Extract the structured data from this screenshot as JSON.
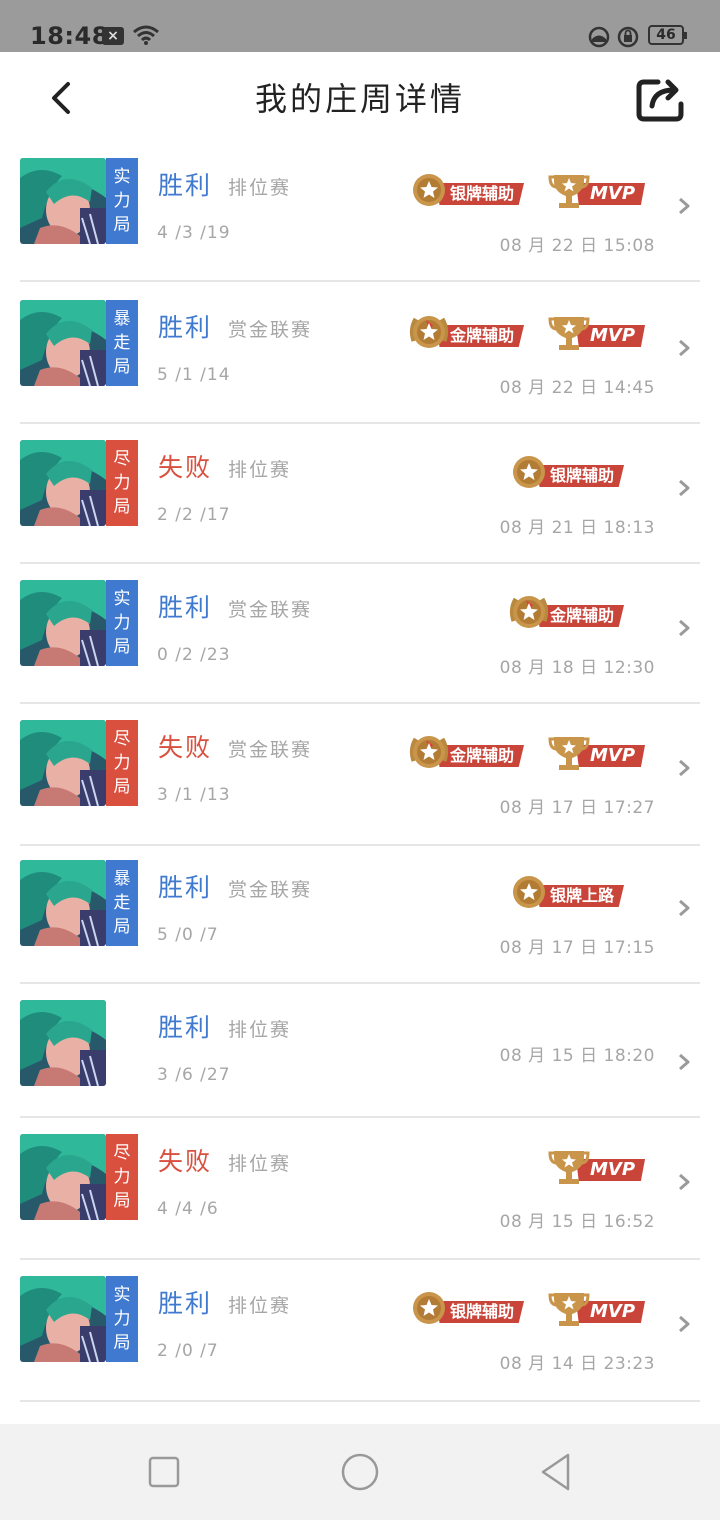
{
  "status_bar": {
    "time": "18:48",
    "battery": "46"
  },
  "header": {
    "title": "我的庄周详情"
  },
  "matches": [
    {
      "mode": "实力局",
      "mode_color": "#3f79d0",
      "result": "胜利",
      "win": true,
      "type": "排位赛",
      "kda": "4 /3 /19",
      "datetime": "08 月 22 日  15:08",
      "badges": [
        {
          "kind": "medal-silver",
          "label": "银牌辅助"
        },
        {
          "kind": "mvp",
          "label": "MVP"
        }
      ]
    },
    {
      "mode": "暴走局",
      "mode_color": "#3f79d0",
      "result": "胜利",
      "win": true,
      "type": "赏金联赛",
      "kda": "5 /1 /14",
      "datetime": "08 月 22 日  14:45",
      "badges": [
        {
          "kind": "medal-gold",
          "label": "金牌辅助"
        },
        {
          "kind": "mvp",
          "label": "MVP"
        }
      ]
    },
    {
      "mode": "尽力局",
      "mode_color": "#d9503f",
      "result": "失败",
      "win": false,
      "type": "排位赛",
      "kda": "2 /2 /17",
      "datetime": "08 月 21 日  18:13",
      "badges": [
        {
          "kind": "medal-silver",
          "label": "银牌辅助"
        }
      ]
    },
    {
      "mode": "实力局",
      "mode_color": "#3f79d0",
      "result": "胜利",
      "win": true,
      "type": "赏金联赛",
      "kda": "0 /2 /23",
      "datetime": "08 月 18 日  12:30",
      "badges": [
        {
          "kind": "medal-gold",
          "label": "金牌辅助"
        }
      ]
    },
    {
      "mode": "尽力局",
      "mode_color": "#d9503f",
      "result": "失败",
      "win": false,
      "type": "赏金联赛",
      "kda": "3 /1 /13",
      "datetime": "08 月 17 日  17:27",
      "badges": [
        {
          "kind": "medal-gold",
          "label": "金牌辅助"
        },
        {
          "kind": "mvp",
          "label": "MVP"
        }
      ]
    },
    {
      "mode": "暴走局",
      "mode_color": "#3f79d0",
      "result": "胜利",
      "win": true,
      "type": "赏金联赛",
      "kda": "5 /0 /7",
      "datetime": "08 月 17 日  17:15",
      "badges": [
        {
          "kind": "medal-silver",
          "label": "银牌上路"
        }
      ]
    },
    {
      "mode": "",
      "mode_color": "",
      "result": "胜利",
      "win": true,
      "type": "排位赛",
      "kda": "3 /6 /27",
      "datetime": "08 月 15 日  18:20",
      "badges": []
    },
    {
      "mode": "尽力局",
      "mode_color": "#d9503f",
      "result": "失败",
      "win": false,
      "type": "排位赛",
      "kda": "4 /4 /6",
      "datetime": "08 月 15 日  16:52",
      "badges": [
        {
          "kind": "mvp",
          "label": "MVP"
        }
      ]
    },
    {
      "mode": "实力局",
      "mode_color": "#3f79d0",
      "result": "胜利",
      "win": true,
      "type": "排位赛",
      "kda": "2 /0 /7",
      "datetime": "08 月 14 日  23:23",
      "badges": [
        {
          "kind": "medal-silver",
          "label": "银牌辅助"
        },
        {
          "kind": "mvp",
          "label": "MVP"
        }
      ]
    }
  ],
  "colors": {
    "win": "#3f79d0",
    "loss": "#d9503f",
    "badge_red": "#c9453a",
    "medal_gold": "#c9954a"
  },
  "icons": [
    "back-icon",
    "share-icon",
    "chevron-right-icon",
    "medal-icon",
    "trophy-icon",
    "nav-square-icon",
    "nav-circle-icon",
    "nav-back-icon"
  ]
}
